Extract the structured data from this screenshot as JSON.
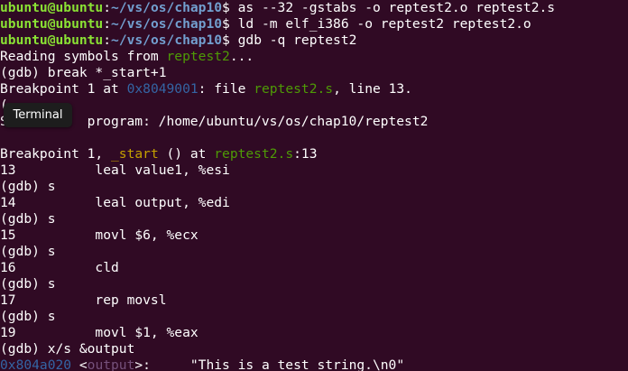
{
  "terminal": {
    "prompt": {
      "user_host": "ubuntu@ubuntu",
      "colon": ":",
      "path": "~/vs/os/chap10",
      "symbol": "$ "
    },
    "cmd1": "as --32 -gstabs -o reptest2.o reptest2.s",
    "cmd2": "ld -m elf_i386 -o reptest2 reptest2.o",
    "cmd3": "gdb -q reptest2",
    "l4_a": "Reading symbols from ",
    "l4_file": "reptest2",
    "l4_b": "...",
    "l5": "(gdb) break *_start+1",
    "l6_a": "Breakpoint 1 at ",
    "l6_addr": "0x8049001",
    "l6_b": ": file ",
    "l6_file": "reptest2.s",
    "l6_c": ", line 13.",
    "l7_partial": "(",
    "l8_partial": "S",
    "l8_rest": " program: /home/ubuntu/vs/os/chap10/reptest2",
    "l10_a": "Breakpoint 1, ",
    "l10_func": "_start",
    "l10_b": " () at ",
    "l10_file": "reptest2.s",
    "l10_c": ":13",
    "l11": "13          leal value1, %esi",
    "l12": "(gdb) s",
    "l13": "14          leal output, %edi",
    "l14": "(gdb) s",
    "l15": "15          movl $6, %ecx",
    "l16": "(gdb) s",
    "l17": "16          cld",
    "l18": "(gdb) s",
    "l19": "17          rep movsl",
    "l20": "(gdb) s",
    "l21": "19          movl $1, %eax",
    "l22": "(gdb) x/s &output",
    "l23_addr": "0x804a020",
    "l23_a": " <",
    "l23_sym": "output",
    "l23_b": ">:     \"This is a test string.\\n0\""
  },
  "tooltip": {
    "label": "Terminal"
  },
  "colors": {
    "background": "#300a24",
    "prompt_user": "#8ae234",
    "prompt_path": "#729fcf",
    "filename": "#4e9a06",
    "address": "#3465a4",
    "function": "#c4a000",
    "symbol": "#75507b"
  }
}
